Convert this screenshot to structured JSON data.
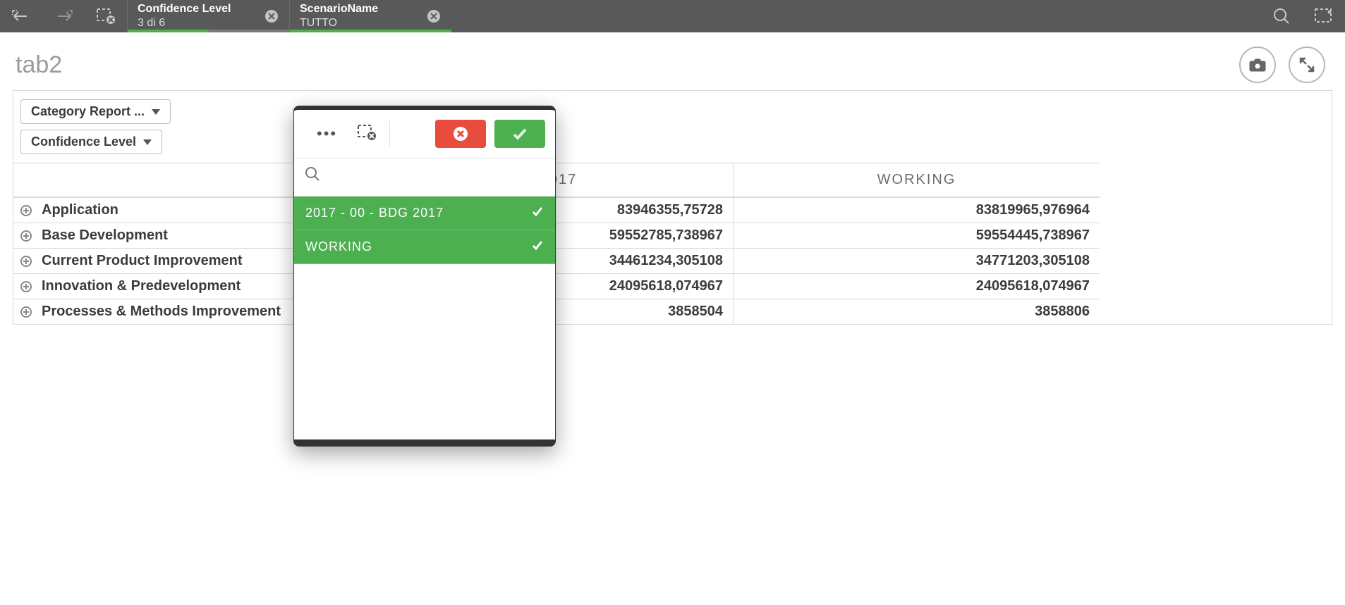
{
  "toolbar": {
    "chips": [
      {
        "title": "Confidence Level",
        "sub": "3 di 6",
        "progress": "half"
      },
      {
        "title": "ScenarioName",
        "sub": "TUTTO",
        "progress": "full"
      }
    ]
  },
  "sheet": {
    "title": "tab2"
  },
  "filters": {
    "category_label": "Category Report ...",
    "confidence_label": "Confidence Level"
  },
  "columns": [
    "",
    "G 2017",
    "WORKING"
  ],
  "rows": [
    {
      "label": "Application",
      "c1": "83946355,75728",
      "c2": "83819965,976964"
    },
    {
      "label": "Base Development",
      "c1": "59552785,738967",
      "c2": "59554445,738967"
    },
    {
      "label": "Current Product Improvement",
      "c1": "34461234,305108",
      "c2": "34771203,305108"
    },
    {
      "label": "Innovation & Predevelopment",
      "c1": "24095618,074967",
      "c2": "24095618,074967"
    },
    {
      "label": "Processes & Methods Improvement",
      "c1": "3858504",
      "c2": "3858806"
    }
  ],
  "popup": {
    "options": [
      {
        "label": "2017 - 00 - BDG 2017",
        "selected": true
      },
      {
        "label": "WORKING",
        "selected": true
      }
    ]
  }
}
